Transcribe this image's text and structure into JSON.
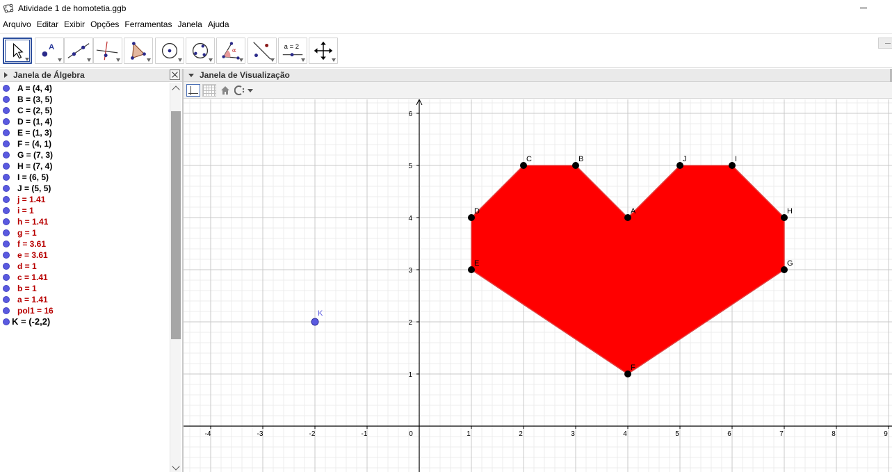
{
  "window": {
    "title": "Atividade 1 de homotetia.ggb"
  },
  "menu": [
    "Arquivo",
    "Editar",
    "Exibir",
    "Opções",
    "Ferramentas",
    "Janela",
    "Ajuda"
  ],
  "toolbar": {
    "tools": [
      {
        "name": "move-tool",
        "icon": "cursor-arrow-icon",
        "selected": true
      },
      {
        "name": "point-tool",
        "icon": "point-A-icon"
      },
      {
        "name": "line-tool",
        "icon": "line-through-points-icon"
      },
      {
        "name": "perpendicular-line-tool",
        "icon": "perpendicular-line-icon"
      },
      {
        "name": "polygon-tool",
        "icon": "polygon-icon"
      },
      {
        "name": "circle-tool",
        "icon": "circle-center-point-icon"
      },
      {
        "name": "circle-three-points-tool",
        "icon": "circle-three-points-icon"
      },
      {
        "name": "angle-tool",
        "icon": "angle-alpha-icon"
      },
      {
        "name": "reflect-tool",
        "icon": "reflect-about-line-icon"
      },
      {
        "name": "slider-tool",
        "icon": "slider-icon",
        "label": "a = 2"
      },
      {
        "name": "move-view-tool",
        "icon": "move-arrows-icon"
      }
    ]
  },
  "algebra": {
    "title": "Janela de Álgebra",
    "items": [
      {
        "text": "A = (4, 4)",
        "kind": "pt"
      },
      {
        "text": "B = (3, 5)",
        "kind": "pt"
      },
      {
        "text": "C = (2, 5)",
        "kind": "pt"
      },
      {
        "text": "D = (1, 4)",
        "kind": "pt"
      },
      {
        "text": "E = (1, 3)",
        "kind": "pt"
      },
      {
        "text": "F = (4, 1)",
        "kind": "pt"
      },
      {
        "text": "G = (7, 3)",
        "kind": "pt"
      },
      {
        "text": "H = (7, 4)",
        "kind": "pt"
      },
      {
        "text": "I = (6, 5)",
        "kind": "pt"
      },
      {
        "text": "J = (5, 5)",
        "kind": "pt"
      },
      {
        "text": "j = 1.41",
        "kind": "num"
      },
      {
        "text": "i = 1",
        "kind": "num"
      },
      {
        "text": "h = 1.41",
        "kind": "num"
      },
      {
        "text": "g = 1",
        "kind": "num"
      },
      {
        "text": "f = 3.61",
        "kind": "num"
      },
      {
        "text": "e = 3.61",
        "kind": "num"
      },
      {
        "text": "d = 1",
        "kind": "num"
      },
      {
        "text": "c = 1.41",
        "kind": "num"
      },
      {
        "text": "b = 1",
        "kind": "num"
      },
      {
        "text": "a = 1.41",
        "kind": "num"
      },
      {
        "text": "pol1 = 16",
        "kind": "num"
      },
      {
        "text": "K = (-2,2)",
        "kind": "aux"
      }
    ]
  },
  "graphics": {
    "title": "Janela de Visualização",
    "x_ticks": [
      "-4",
      "-3",
      "-2",
      "-1",
      "0",
      "1",
      "2",
      "3",
      "4",
      "5",
      "6",
      "7",
      "8",
      "9"
    ],
    "y_ticks": [
      "1",
      "2",
      "3",
      "4",
      "5",
      "6"
    ],
    "polygon_color": "#ff0000",
    "point_color": "#000000",
    "free_point_color": "#5a5ae0",
    "polygon_vertices": [
      {
        "name": "C",
        "x": 2,
        "y": 5
      },
      {
        "name": "B",
        "x": 3,
        "y": 5
      },
      {
        "name": "A",
        "x": 4,
        "y": 4
      },
      {
        "name": "J",
        "x": 5,
        "y": 5
      },
      {
        "name": "I",
        "x": 6,
        "y": 5
      },
      {
        "name": "H",
        "x": 7,
        "y": 4
      },
      {
        "name": "G",
        "x": 7,
        "y": 3
      },
      {
        "name": "F",
        "x": 4,
        "y": 1
      },
      {
        "name": "E",
        "x": 1,
        "y": 3
      },
      {
        "name": "D",
        "x": 1,
        "y": 4
      }
    ],
    "free_point": {
      "name": "K",
      "x": -2,
      "y": 2
    }
  }
}
